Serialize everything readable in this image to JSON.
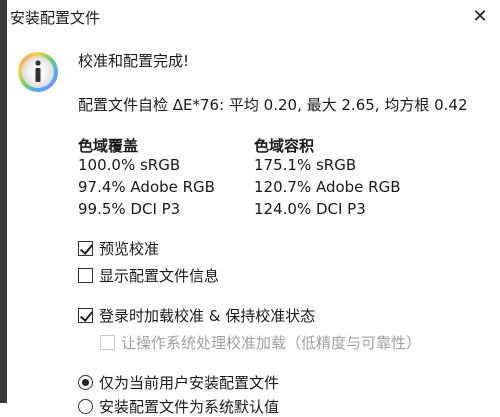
{
  "window": {
    "title": "安装配置文件",
    "close_glyph": "✕"
  },
  "message": {
    "headline": "校准和配置完成!",
    "self_check": "配置文件自检 ΔE*76: 平均 0.20, 最大 2.65, 均方根 0.42"
  },
  "coverage": {
    "header": "色域覆盖",
    "rows": [
      "100.0% sRGB",
      "97.4% Adobe RGB",
      "99.5% DCI P3"
    ]
  },
  "volume": {
    "header": "色域容积",
    "rows": [
      "175.1% sRGB",
      "120.7% Adobe RGB",
      "124.0% DCI P3"
    ]
  },
  "options": {
    "preview_label": "预览校准",
    "show_info_label": "显示配置文件信息",
    "load_on_login_label": "登录时加载校准 & 保持校准状态",
    "os_load_label": "让操作系统处理校准加载（低精度与可靠性）"
  },
  "install_scope": {
    "current_user_label": "仅为当前用户安装配置文件",
    "partial_label": "安装配置文件为系统默认值"
  }
}
